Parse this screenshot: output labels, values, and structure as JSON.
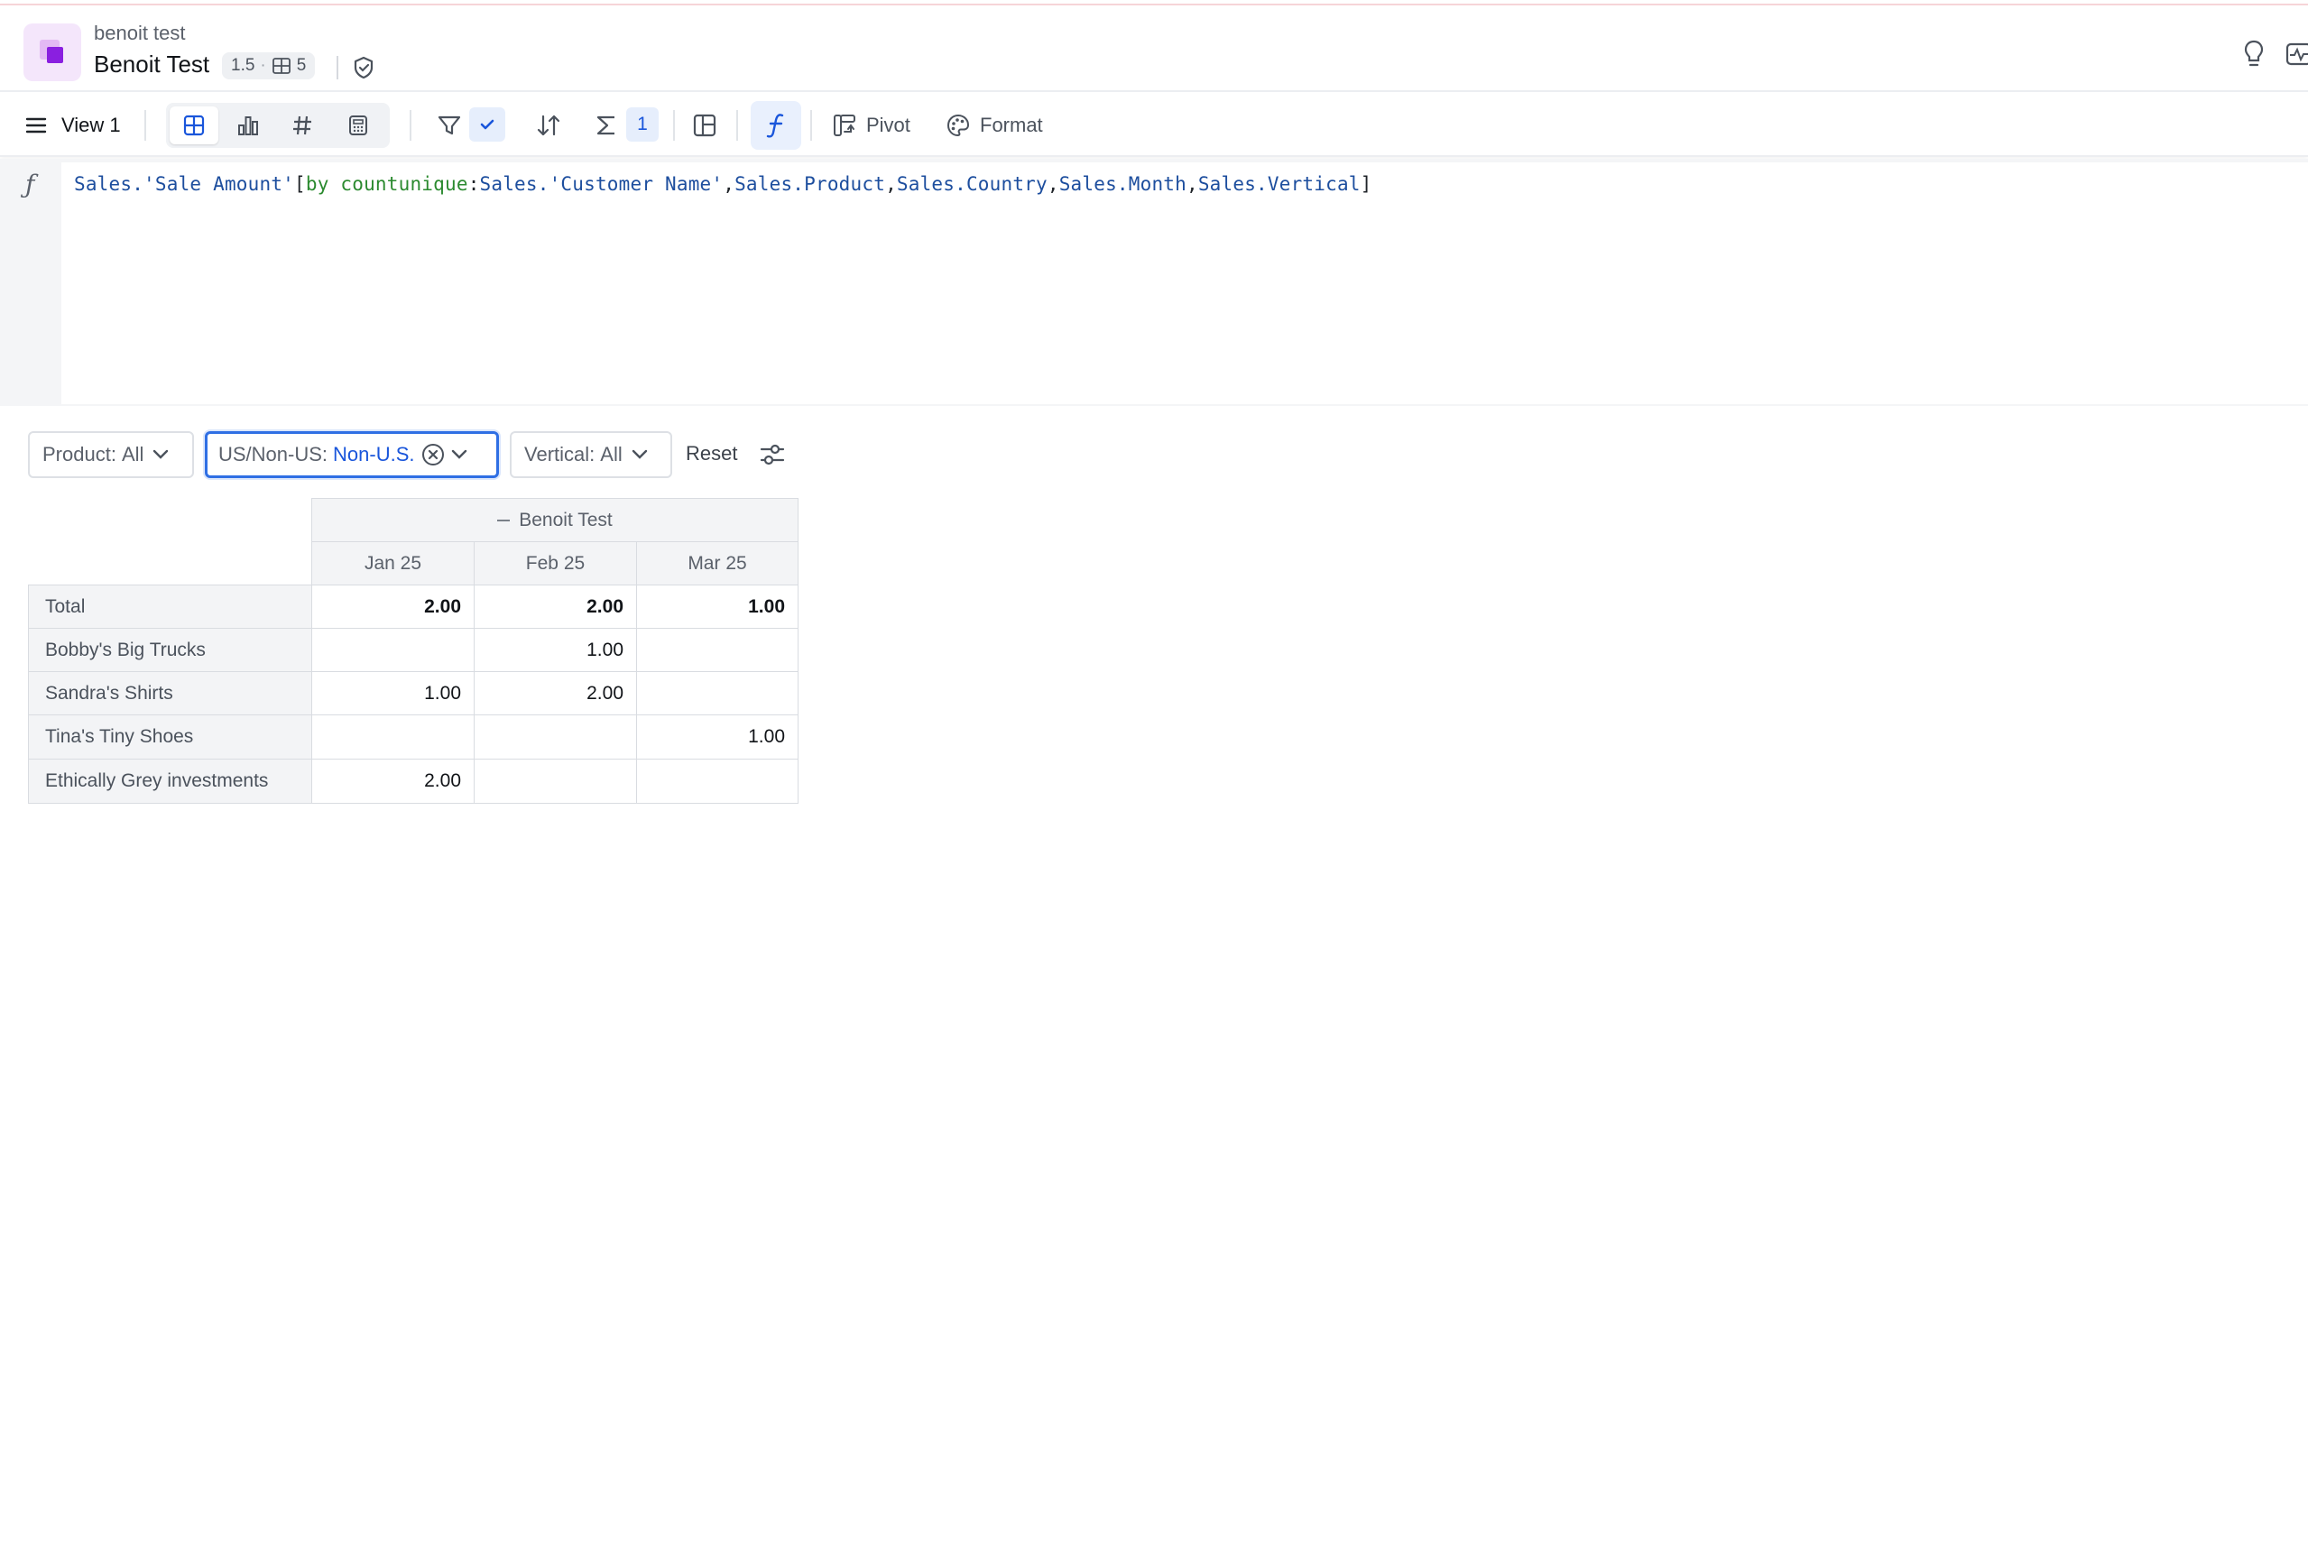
{
  "header": {
    "workbook_name": "benoit test",
    "page_title": "Benoit Test",
    "version": "1.5",
    "separator_dot": "·",
    "element_count": "5"
  },
  "toolbar": {
    "view_name": "View 1",
    "summary_count": "1",
    "pivot_label": "Pivot",
    "format_label": "Format",
    "active_viz": "table-icon"
  },
  "formula": {
    "symbol": "ƒ",
    "parts": {
      "p1": "Sales.'Sale Amount'",
      "p2": "[",
      "p3": "by countunique",
      "p4": ":",
      "p5": "Sales.'Customer Name'",
      "p6": ",",
      "p7": "Sales.Product",
      "p8": ",",
      "p9": "Sales.Country",
      "p10": ",",
      "p11": "Sales.Month",
      "p12": ",",
      "p13": "Sales.Vertical",
      "p14": "]"
    }
  },
  "filters": {
    "product": {
      "label": "Product:",
      "value": "All"
    },
    "us_non_us": {
      "label": "US/Non-US:",
      "value": "Non-U.S."
    },
    "vertical": {
      "label": "Vertical:",
      "value": "All"
    },
    "reset_label": "Reset"
  },
  "table": {
    "group_header": "Benoit Test",
    "columns": [
      "Jan 25",
      "Feb 25",
      "Mar 25"
    ],
    "rows": [
      {
        "label": "Total",
        "values": [
          "2.00",
          "2.00",
          "1.00"
        ]
      },
      {
        "label": "Bobby's Big Trucks",
        "values": [
          "",
          "1.00",
          ""
        ]
      },
      {
        "label": "Sandra's Shirts",
        "values": [
          "1.00",
          "2.00",
          ""
        ]
      },
      {
        "label": "Tina's Tiny Shoes",
        "values": [
          "",
          "",
          "1.00"
        ]
      },
      {
        "label": "Ethically Grey investments",
        "values": [
          "2.00",
          "",
          ""
        ]
      }
    ]
  },
  "colors": {
    "accent": "#1a56db",
    "formula_keyword": "#2b8a2f",
    "brand": "#8a1fe0"
  }
}
